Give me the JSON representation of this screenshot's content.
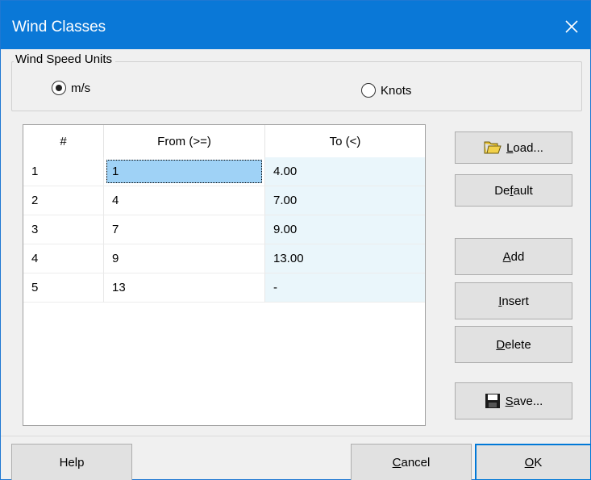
{
  "window": {
    "title": "Wind Classes",
    "close_glyph": "✕"
  },
  "units": {
    "group_label": "Wind Speed Units",
    "options": [
      {
        "label": "m/s",
        "selected": true
      },
      {
        "label": "Knots",
        "selected": false
      }
    ]
  },
  "table": {
    "headers": [
      "#",
      "From (>=)",
      "To (<)"
    ],
    "rows": [
      {
        "num": "1",
        "from": "1",
        "to": "4.00",
        "selected": true
      },
      {
        "num": "2",
        "from": "4",
        "to": "7.00"
      },
      {
        "num": "3",
        "from": "7",
        "to": "9.00"
      },
      {
        "num": "4",
        "from": "9",
        "to": "13.00"
      },
      {
        "num": "5",
        "from": "13",
        "to": "-"
      }
    ]
  },
  "side_buttons": {
    "load": {
      "label": "Load...",
      "mnemonic": "L",
      "icon": "folder-icon"
    },
    "default": {
      "label": "Default",
      "mnemonic": "f"
    },
    "add": {
      "label": "Add",
      "mnemonic": "A"
    },
    "insert": {
      "label": "Insert",
      "mnemonic": "I"
    },
    "delete": {
      "label": "Delete",
      "mnemonic": "D"
    },
    "save": {
      "label": "Save...",
      "mnemonic": "S",
      "icon": "floppy-disk-icon"
    }
  },
  "footer": {
    "help": "Help",
    "cancel": "Cancel",
    "ok": "OK"
  },
  "colors": {
    "titlebar": "#0a78d7",
    "selection": "#9fd2f6",
    "to_column": "#eaf6fb",
    "default_button_border": "#0078d7"
  }
}
